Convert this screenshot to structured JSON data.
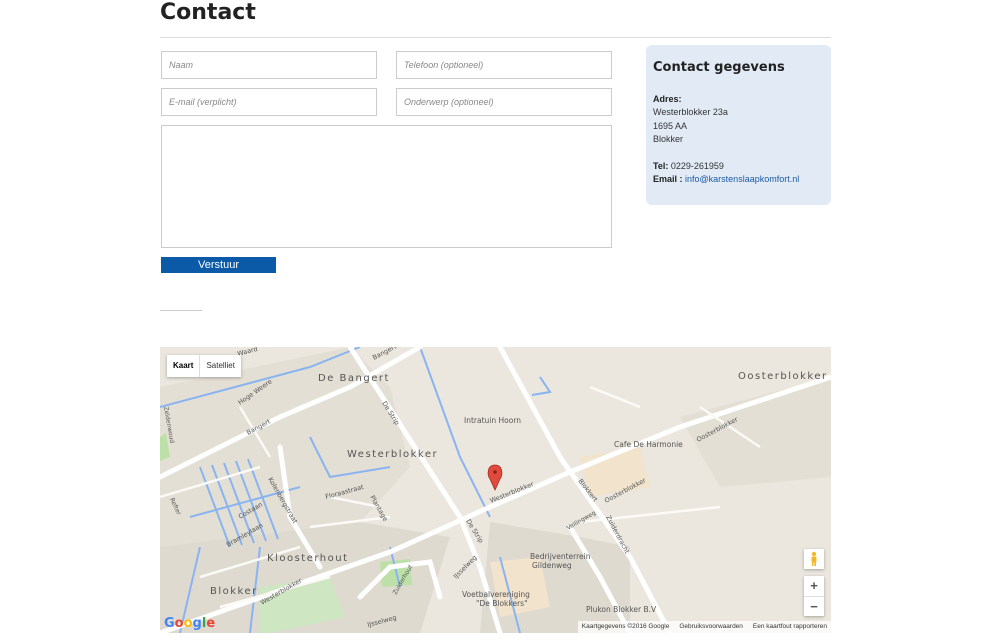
{
  "page": {
    "title": "Contact"
  },
  "form": {
    "name_placeholder": "Naam",
    "phone_placeholder": "Telefoon (optioneel)",
    "email_placeholder": "E-mail (verplicht)",
    "subject_placeholder": "Onderwerp (optioneel)",
    "message_placeholder": "",
    "submit_label": "Verstuur"
  },
  "contact": {
    "heading": "Contact gegevens",
    "address_label": "Adres:",
    "street": "Westerblokker 23a",
    "postcode": "1695 AA",
    "city": "Blokker",
    "tel_label": "Tel:",
    "tel": "0229-261959",
    "email_label": "Email :",
    "email": "info@karstenslaapkomfort.nl"
  },
  "map": {
    "type_buttons": [
      "Kaart",
      "Satelliet"
    ],
    "active_type": "Kaart",
    "zoom_in": "+",
    "zoom_out": "−",
    "logo": "Google",
    "footer": [
      "Kaartgegevens ©2016 Google",
      "Gebruiksvoorwaarden",
      "Een kaartfout rapporteren"
    ],
    "places": {
      "de_bangert": "De Bangert",
      "westerblokker_area": "Westerblokker",
      "kloosterhout": "Kloosterhout",
      "blokker": "Blokker",
      "oosterblokker": "Oosterblokker",
      "intratuin": "Intratuin Hoorn",
      "cafe": "Cafe De Harmonie",
      "bedrijventerrein": "Bedrijventerrein",
      "gildenweg_poi": "Gildenweg",
      "voetbal1": "Voetbalvereniging",
      "voetbal2": "\"De Blokkers\"",
      "plukon": "Plukon Blokker B.V"
    },
    "streets": {
      "waard": "Waard",
      "bangert1": "Bangert",
      "bangert2": "Bangert",
      "hoge_weere": "Hoge Weere",
      "de_strip1": "De Strip",
      "de_strip2": "De Strip",
      "westerblokker_st": "Westerblokker",
      "westerblokker_st2": "Westerblokker",
      "oosterblokker_st": "Oosterblokker",
      "oosterblokker_st2": "Oosterblokker",
      "blokkert": "Blokkert",
      "zuiderdracht": "Zuiderdracht",
      "veilingweg": "Veilingweg",
      "floraastraat": "Floraastraat",
      "plantage": "Plantage",
      "kolenbergstraat": "Kolenbergstraat",
      "costaan": "Costaan",
      "bramleylaan": "Bramleylaan",
      "lisselweg": "IJsselweg",
      "lisselweg2": "IJsselweg",
      "zuiderhout": "Zuiderhout",
      "zeldenwoud": "Zeldenwoud",
      "refter": "Refter"
    }
  }
}
